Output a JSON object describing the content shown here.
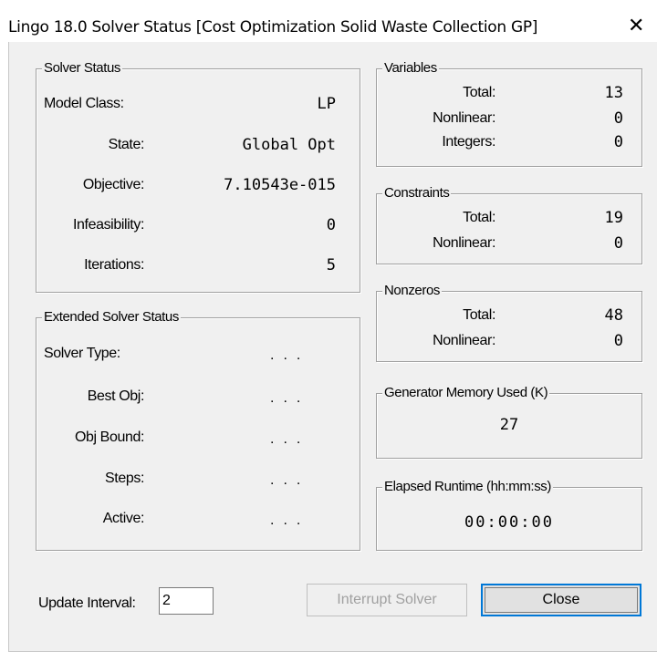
{
  "window": {
    "title": "Lingo 18.0 Solver Status [Cost Optimization Solid Waste Collection GP]",
    "close_glyph": "✕"
  },
  "solver_status": {
    "legend": "Solver Status",
    "rows": [
      {
        "label": "Model Class:",
        "value": "LP"
      },
      {
        "label": "State:",
        "value": "Global Opt"
      },
      {
        "label": "Objective:",
        "value": "7.10543e-015"
      },
      {
        "label": "Infeasibility:",
        "value": "0"
      },
      {
        "label": "Iterations:",
        "value": "5"
      }
    ]
  },
  "extended_solver_status": {
    "legend": "Extended Solver Status",
    "rows": [
      {
        "label": "Solver Type:",
        "value": "..."
      },
      {
        "label": "Best Obj:",
        "value": "..."
      },
      {
        "label": "Obj Bound:",
        "value": "..."
      },
      {
        "label": "Steps:",
        "value": "..."
      },
      {
        "label": "Active:",
        "value": "..."
      }
    ]
  },
  "variables": {
    "legend": "Variables",
    "total_label": "Total:",
    "total": "13",
    "nonlinear_label": "Nonlinear:",
    "nonlinear": "0",
    "integers_label": "Integers:",
    "integers": "0"
  },
  "constraints": {
    "legend": "Constraints",
    "total_label": "Total:",
    "total": "19",
    "nonlinear_label": "Nonlinear:",
    "nonlinear": "0"
  },
  "nonzeros": {
    "legend": "Nonzeros",
    "total_label": "Total:",
    "total": "48",
    "nonlinear_label": "Nonlinear:",
    "nonlinear": "0"
  },
  "generator_memory": {
    "legend": "Generator Memory Used (K)",
    "value": "27"
  },
  "elapsed_runtime": {
    "legend": "Elapsed Runtime (hh:mm:ss)",
    "value": "00:00:00"
  },
  "update_interval": {
    "label": "Update Interval:",
    "value": "2"
  },
  "buttons": {
    "interrupt": "Interrupt Solver",
    "close": "Close"
  }
}
